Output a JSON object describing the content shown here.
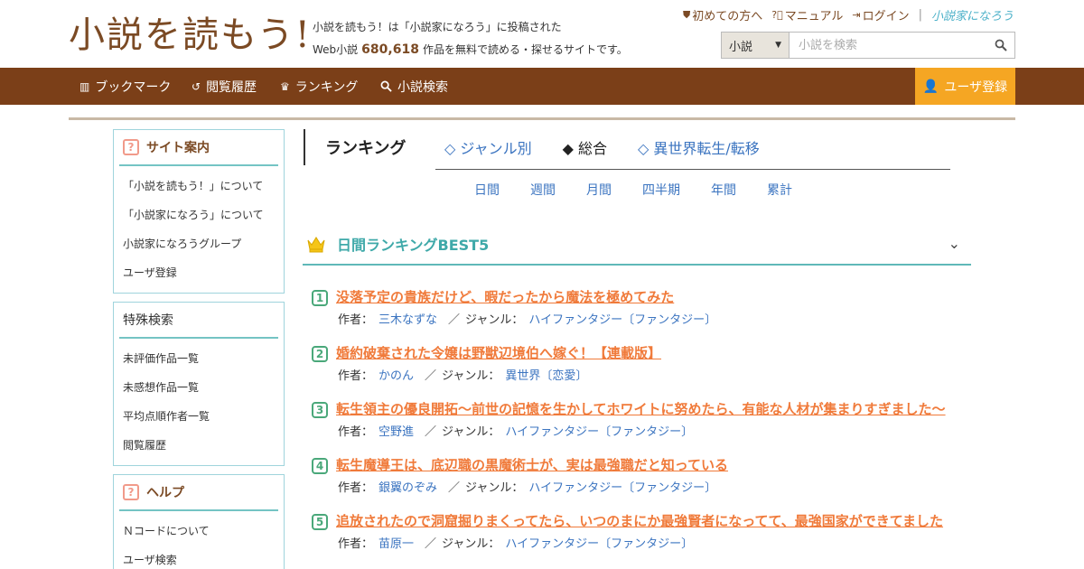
{
  "header": {
    "logo": "小説を読もう!",
    "tagline_line1": "小説を読もう！は「小説家になろう」に投稿された",
    "tagline_pre": "Web小説",
    "tagline_count": "680,618",
    "tagline_post": "作品を無料で読める・探せるサイトです。",
    "links": [
      "初めての方へ",
      "マニュアル",
      "ログイン"
    ],
    "narou_logo": "小説家になろう",
    "search": {
      "select_value": "小説",
      "placeholder": "小説を検索"
    }
  },
  "nav": {
    "items": [
      "ブックマーク",
      "閲覧履歴",
      "ランキング",
      "小説検索"
    ],
    "register": "ユーザ登録"
  },
  "sidebar": {
    "guide": {
      "title": "サイト案内",
      "items": [
        "「小説を読もう！」について",
        "「小説家になろう」について",
        "小説家になろうグループ",
        "ユーザ登録"
      ]
    },
    "special": {
      "title": "特殊検索",
      "items": [
        "未評価作品一覧",
        "未感想作品一覧",
        "平均点順作者一覧",
        "閲覧履歴"
      ]
    },
    "help": {
      "title": "ヘルプ",
      "items": [
        "Ｎコードについて",
        "ユーザ検索"
      ]
    }
  },
  "ranking": {
    "heading": "ランキング",
    "tabs": [
      "◇ ジャンル別",
      "◆ 総合",
      "◇ 異世界転生/転移"
    ],
    "periods": [
      "日間",
      "週間",
      "月間",
      "四半期",
      "年間",
      "累計"
    ],
    "best_title": "日間ランキングBEST5",
    "author_label": "作者：",
    "genre_label": "ジャンル：",
    "items": [
      {
        "num": "1",
        "title": "没落予定の貴族だけど、暇だったから魔法を極めてみた",
        "author": "三木なずな",
        "genre": "ハイファンタジー〔ファンタジー〕"
      },
      {
        "num": "2",
        "title": "婚約破棄された令嬢は野獣辺境伯へ嫁ぐ！【連載版】",
        "author": "かのん",
        "genre": "異世界〔恋愛〕"
      },
      {
        "num": "3",
        "title": "転生領主の優良開拓〜前世の記憶を生かしてホワイトに努めたら、有能な人材が集まりすぎました〜",
        "author": "空野進",
        "genre": "ハイファンタジー〔ファンタジー〕"
      },
      {
        "num": "4",
        "title": "転生魔導王は、底辺職の黒魔術士が、実は最強職だと知っている",
        "author": "銀翼のぞみ",
        "genre": "ハイファンタジー〔ファンタジー〕"
      },
      {
        "num": "5",
        "title": "追放されたので洞窟掘りまくってたら、いつのまにか最強賢者になってて、最強国家ができてました",
        "author": "苗原一",
        "genre": "ハイファンタジー〔ファンタジー〕"
      }
    ]
  },
  "colors": {
    "brand": "#7b3f18",
    "accent": "#f5a623",
    "link": "#3b74c0",
    "title_link": "#f07a3a",
    "teal": "#3fa9a9"
  }
}
